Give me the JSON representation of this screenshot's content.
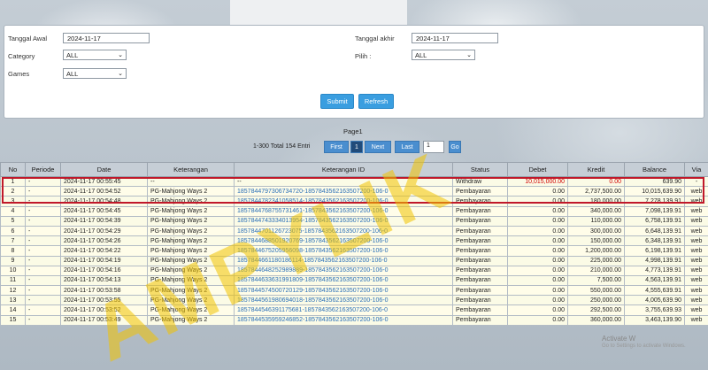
{
  "filters": {
    "tanggal_awal_label": "Tanggal Awal",
    "tanggal_awal_value": "2024-11-17",
    "tanggal_akhir_label": "Tanggal akhir",
    "tanggal_akhir_value": "2024-11-17",
    "category_label": "Category",
    "category_value": "ALL",
    "pilih_label": "Pilih",
    "pilih_colon": ":",
    "pilih_value": "ALL",
    "games_label": "Games",
    "games_value": "ALL",
    "submit_label": "Submit",
    "refresh_label": "Refresh"
  },
  "pager": {
    "title": "Page1",
    "info": "1-300 Total 154 Entri",
    "first": "First",
    "current": "1",
    "next": "Next",
    "last": "Last",
    "input_value": "1",
    "go": "Go"
  },
  "table": {
    "headers": [
      "No",
      "Periode",
      "Date",
      "Keterangan",
      "Keterangan ID",
      "Status",
      "Debet",
      "Kredit",
      "Balance",
      "Via"
    ],
    "rows": [
      [
        "1",
        "-",
        "2024-11-17 00:55:45",
        "--",
        "--",
        "Withdraw",
        "10,015,000.00",
        "0.00",
        "639.90",
        "-"
      ],
      [
        "2",
        "-",
        "2024-11-17 00:54:52",
        "PG-Mahjong Ways 2",
        "1857844797306734720-1857843562163507200-106-0",
        "Pembayaran",
        "0.00",
        "2,737,500.00",
        "10,015,639.90",
        "web"
      ],
      [
        "3",
        "-",
        "2024-11-17 00:54:48",
        "PG-Mahjong Ways 2",
        "1857844782341058514-1857843562163507200-106-0",
        "Pembayaran",
        "0.00",
        "180,000.00",
        "7,278,139.91",
        "web"
      ],
      [
        "4",
        "-",
        "2024-11-17 00:54:45",
        "PG-Mahjong Ways 2",
        "1857844768755731461-1857843562163507200-106-0",
        "Pembayaran",
        "0.00",
        "340,000.00",
        "7,098,139.91",
        "web"
      ],
      [
        "5",
        "-",
        "2024-11-17 00:54:39",
        "PG-Mahjong Ways 2",
        "1857844743334013954-1857843562163507200-106-0",
        "Pembayaran",
        "0.00",
        "110,000.00",
        "6,758,139.91",
        "web"
      ],
      [
        "6",
        "-",
        "2024-11-17 00:54:29",
        "PG-Mahjong Ways 2",
        "1857844701126723075-1857843562163507200-106-0",
        "Pembayaran",
        "0.00",
        "300,000.00",
        "6,648,139.91",
        "web"
      ],
      [
        "7",
        "-",
        "2024-11-17 00:54:26",
        "PG-Mahjong Ways 2",
        "1857844688501920769-1857843562163507200-106-0",
        "Pembayaran",
        "0.00",
        "150,000.00",
        "6,348,139.91",
        "web"
      ],
      [
        "8",
        "-",
        "2024-11-17 00:54:22",
        "PG-Mahjong Ways 2",
        "1857844675205956098-1857843562163507200-106-0",
        "Pembayaran",
        "0.00",
        "1,200,000.00",
        "6,198,139.91",
        "web"
      ],
      [
        "9",
        "-",
        "2024-11-17 00:54:19",
        "PG-Mahjong Ways 2",
        "1857844661180186114-1857843562163507200-106-0",
        "Pembayaran",
        "0.00",
        "225,000.00",
        "4,998,139.91",
        "web"
      ],
      [
        "10",
        "-",
        "2024-11-17 00:54:16",
        "PG-Mahjong Ways 2",
        "1857844648252989889-1857843562163507200-106-0",
        "Pembayaran",
        "0.00",
        "210,000.00",
        "4,773,139.91",
        "web"
      ],
      [
        "11",
        "-",
        "2024-11-17 00:54:13",
        "PG-Mahjong Ways 2",
        "1857844633631991809-1857843562163507200-106-0",
        "Pembayaran",
        "0.00",
        "7,500.00",
        "4,563,139.91",
        "web"
      ],
      [
        "12",
        "-",
        "2024-11-17 00:53:58",
        "PG-Mahjong Ways 2",
        "1857844574500720129-1857843562163507200-106-0",
        "Pembayaran",
        "0.00",
        "550,000.00",
        "4,555,639.91",
        "web"
      ],
      [
        "13",
        "-",
        "2024-11-17 00:53:55",
        "PG-Mahjong Ways 2",
        "1857844561980694018-1857843562163507200-106-0",
        "Pembayaran",
        "0.00",
        "250,000.00",
        "4,005,639.90",
        "web"
      ],
      [
        "14",
        "-",
        "2024-11-17 00:53:52",
        "PG-Mahjong Ways 2",
        "1857844546391175681-1857843562163507200-106-0",
        "Pembayaran",
        "0.00",
        "292,500.00",
        "3,755,639.93",
        "web"
      ],
      [
        "15",
        "-",
        "2024-11-17 00:53:49",
        "PG-Mahjong Ways 2",
        "1857844535959246852-1857843562163507200-106-0",
        "Pembayaran",
        "0.00",
        "360,000.00",
        "3,463,139.90",
        "web"
      ]
    ]
  },
  "watermark": "AMPYLIK",
  "windows_notice": {
    "line1": "Activate W",
    "line2": "Go to Settings to activate Windows."
  },
  "colors": {
    "highlight_border": "#c0182a",
    "debet_red": "#d10000",
    "link_blue": "#2a6fb8",
    "button_blue": "#3a9ee0"
  }
}
